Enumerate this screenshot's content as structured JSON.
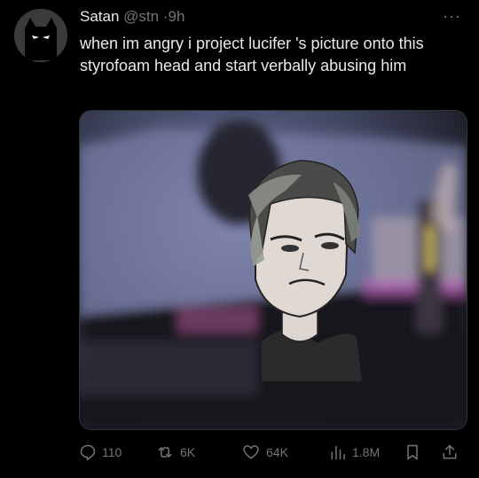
{
  "tweet": {
    "author_name": "Satan",
    "author_handle": "@stn",
    "separator": "·",
    "time": "9h",
    "more": "···",
    "text": "when im angry i project   lucifer  's picture onto this styrofoam head and start verbally abusing him"
  },
  "actions": {
    "replies": "110",
    "reposts": "6K",
    "likes": "64K",
    "views": "1.8M"
  },
  "icons": {
    "avatar": "black-cat-icon",
    "reply": "reply-icon",
    "repost": "repost-icon",
    "like": "heart-icon",
    "views": "views-icon",
    "bookmark": "bookmark-icon",
    "share": "share-icon"
  },
  "colors": {
    "background": "#000000",
    "text": "#e7e9ea",
    "secondary": "#71767b"
  }
}
